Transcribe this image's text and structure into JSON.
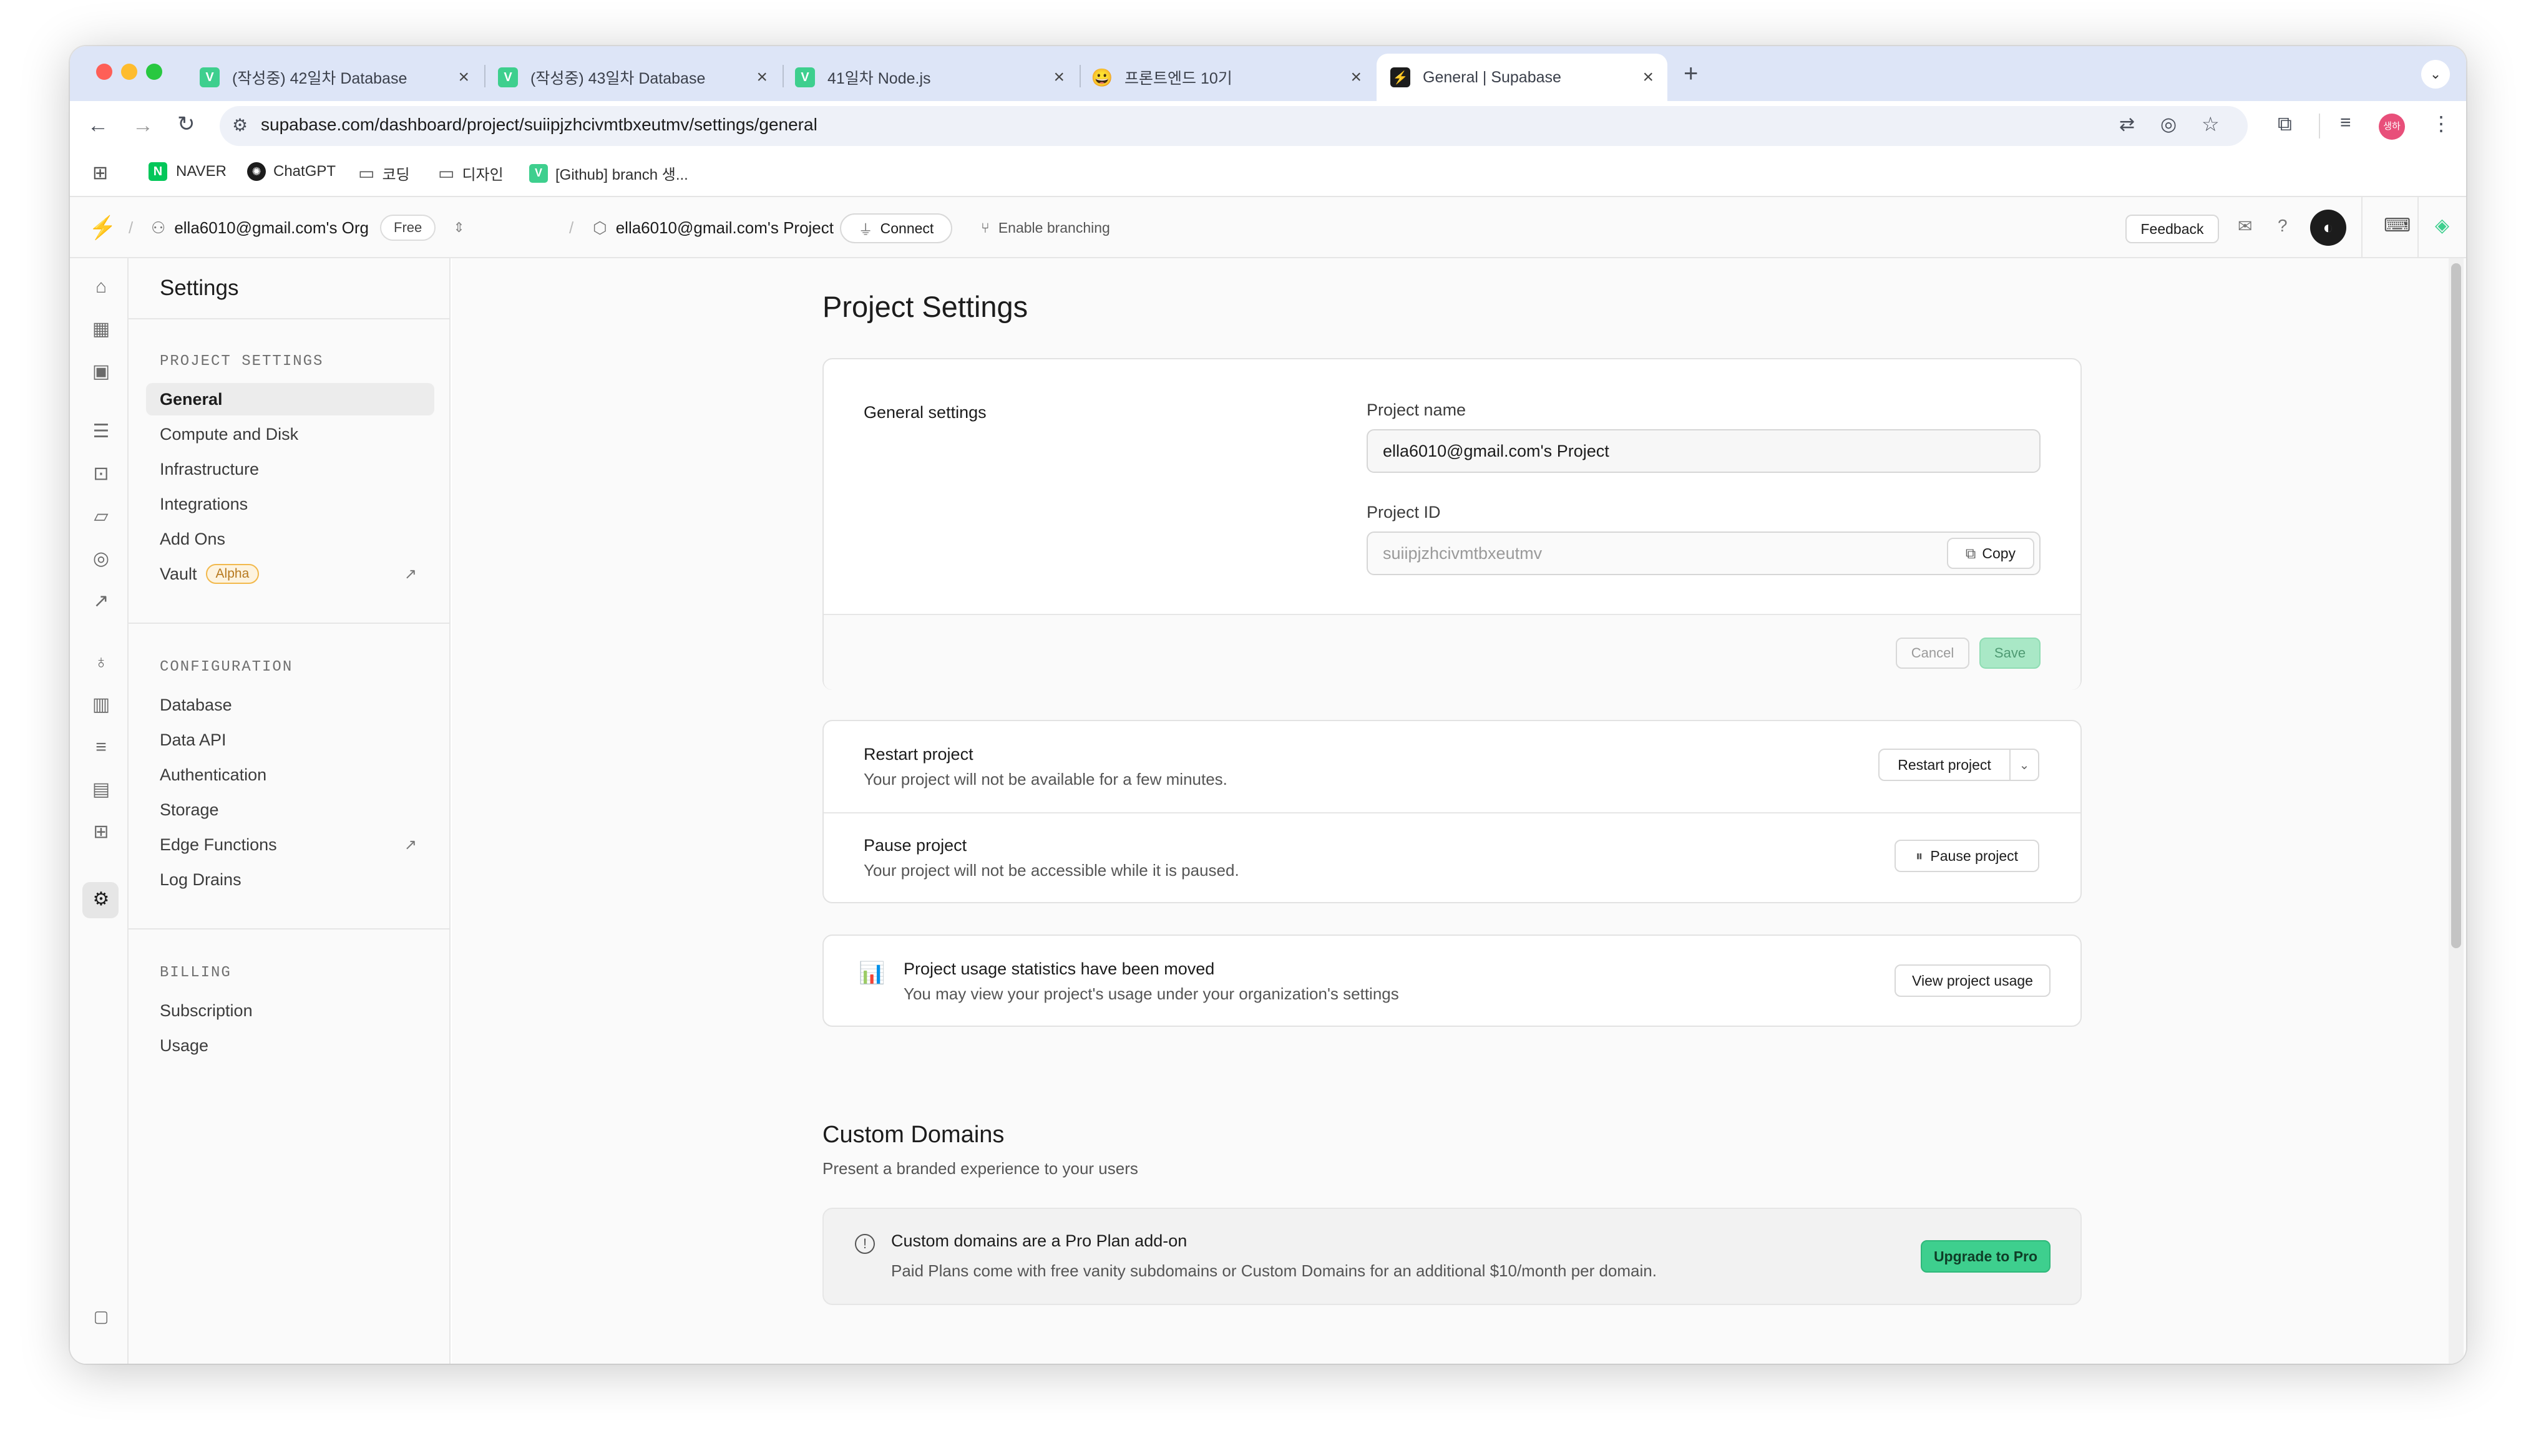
{
  "browser": {
    "tabs": [
      {
        "label": "(작성중) 42일차 Database",
        "favicon": "V"
      },
      {
        "label": "(작성중) 43일차 Database",
        "favicon": "V"
      },
      {
        "label": "41일차 Node.js",
        "favicon": "V"
      },
      {
        "label": "프론트엔드 10기",
        "favicon": "😀"
      },
      {
        "label": "General | Supabase",
        "favicon": "⚡"
      }
    ],
    "url": "supabase.com/dashboard/project/suiipjzhcivmtbxeutmv/settings/general",
    "bookmarks": [
      "NAVER",
      "ChatGPT",
      "코딩",
      "디자인",
      "[Github] branch 생..."
    ],
    "profile_initials": "생하",
    "colors": {
      "accent": "#3ecf8e",
      "tabbar": "#dde5f7"
    }
  },
  "topnav": {
    "org": "ella6010@gmail.com's Org",
    "plan_badge": "Free",
    "project": "ella6010@gmail.com's Project",
    "connect": "Connect",
    "branching": "Enable branching",
    "feedback": "Feedback"
  },
  "sidebar": {
    "title": "Settings",
    "project_settings": {
      "heading": "PROJECT SETTINGS",
      "items": [
        "General",
        "Compute and Disk",
        "Infrastructure",
        "Integrations",
        "Add Ons",
        "Vault"
      ],
      "vault_badge": "Alpha"
    },
    "configuration": {
      "heading": "CONFIGURATION",
      "items": [
        "Database",
        "Data API",
        "Authentication",
        "Storage",
        "Edge Functions",
        "Log Drains"
      ]
    },
    "billing": {
      "heading": "BILLING",
      "items": [
        "Subscription",
        "Usage"
      ]
    }
  },
  "main": {
    "page_title": "Project Settings",
    "general": {
      "section_label": "General settings",
      "project_name_label": "Project name",
      "project_name_value": "ella6010@gmail.com's Project",
      "project_id_label": "Project ID",
      "project_id_value": "suiipjzhcivmtbxeutmv",
      "copy": "Copy",
      "cancel": "Cancel",
      "save": "Save"
    },
    "restart": {
      "title": "Restart project",
      "desc": "Your project will not be available for a few minutes.",
      "button": "Restart project"
    },
    "pause": {
      "title": "Pause project",
      "desc": "Your project will not be accessible while it is paused.",
      "button": "Pause project"
    },
    "usage": {
      "title": "Project usage statistics have been moved",
      "desc": "You may view your project's usage under your organization's settings",
      "button": "View project usage"
    },
    "custom_domains": {
      "title": "Custom Domains",
      "subtitle": "Present a branded experience to your users",
      "notice_title": "Custom domains are a Pro Plan add-on",
      "notice_desc": "Paid Plans come with free vanity subdomains or Custom Domains for an additional $10/month per domain.",
      "upgrade": "Upgrade to Pro"
    }
  }
}
